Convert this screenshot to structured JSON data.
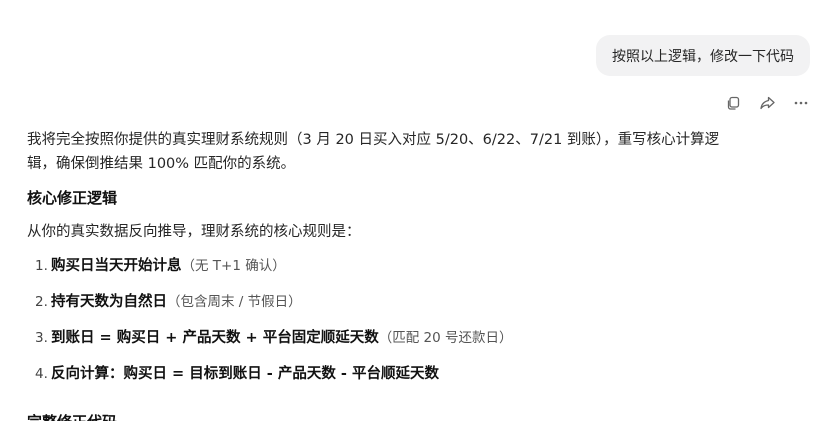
{
  "user_message": "按照以上逻辑，修改一下代码",
  "actions": {
    "copy_icon": "copy-icon",
    "share_icon": "share-icon",
    "more_icon": "more-icon"
  },
  "answer": {
    "intro_line1": "我将完全按照你提供的真实理财系统规则（3 月 20 日买入对应 5/20、6/22、7/21 到账），重写核心计算逻",
    "intro_line2": "辑，确保倒推结果 100% 匹配你的系统。",
    "heading": "核心修正逻辑",
    "derive_text": "从你的真实数据反向推导，理财系统的核心规则是：",
    "rules": [
      {
        "num": "1.",
        "strong": "购买日当天开始计息",
        "note": "（无 T+1 确认）"
      },
      {
        "num": "2.",
        "strong": "持有天数为自然日",
        "note": "（包含周末 / 节假日）"
      },
      {
        "num": "3.",
        "strong": "到账日 = 购买日 + 产品天数 + 平台固定顺延天数",
        "note": "（匹配 20 号还款日）"
      },
      {
        "num": "4.",
        "strong": "反向计算：购买日 = 目标到账日 - 产品天数 - 平台顺延天数",
        "note": ""
      }
    ],
    "partial_heading": "完整修正代码"
  }
}
